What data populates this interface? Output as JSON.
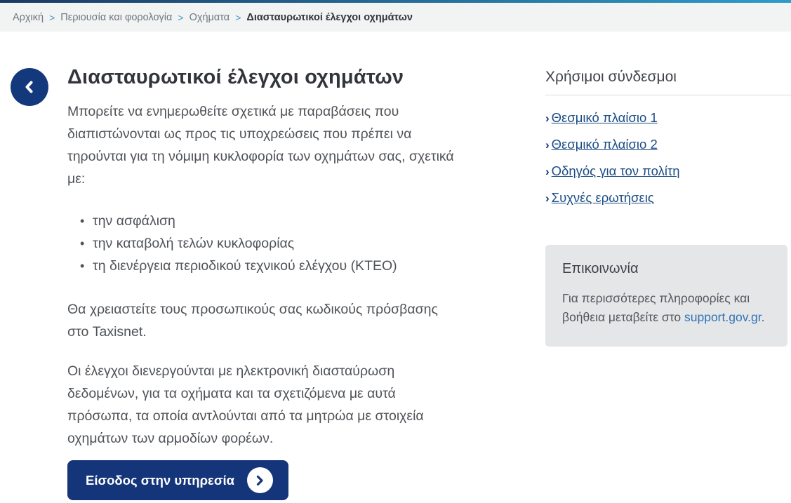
{
  "theme": {
    "accent_navy": "#13387b",
    "top_bar_gradient_start": "#1b3a64",
    "top_bar_gradient_end": "#2f9cc9",
    "sidebar_link_blue": "#1b4c86",
    "support_link_blue": "#3173b4",
    "contact_box_bg": "#e4e6e8",
    "breadcrumb_bg": "#f2f3f3"
  },
  "breadcrumb": {
    "separator": ">",
    "items": [
      {
        "label": "Αρχική"
      },
      {
        "label": "Περιουσία και φορολογία"
      },
      {
        "label": "Οχήματα"
      }
    ],
    "current": "Διασταυρωτικοί έλεγχοι οχημάτων"
  },
  "main": {
    "title": "Διασταυρωτικοί έλεγχοι οχημάτων",
    "intro": "Μπορείτε να  ενημερωθείτε σχετικά με παραβάσεις που διαπιστώνονται ως προς τις υποχρεώσεις που πρέπει να τηρούνται για τη νόμιμη κυκλοφορία των οχημάτων σας, σχετικά με:",
    "bullets": [
      "την ασφάλιση",
      "την καταβολή τελών κυκλοφορίας",
      "τη διενέργεια περιοδικού τεχνικού ελέγχου (ΚΤΕΟ)"
    ],
    "paragraph_credentials": "Θα χρειαστείτε τους προσωπικούς σας κωδικούς πρόσβασης στο Taxisnet.",
    "paragraph_checks": "Οι έλεγχοι διενεργούνται με ηλεκτρονική διασταύρωση δεδομένων, για τα οχήματα και τα σχετιζόμενα με αυτά πρόσωπα, τα οποία αντλούνται από τα μητρώα με στοιχεία οχημάτων των αρμοδίων φορέων.",
    "login_button_label": "Είσοδος στην υπηρεσία"
  },
  "sidebar": {
    "useful_links_title": "Χρήσιμοι σύνδεσμοι",
    "link_chevron": "›",
    "links": [
      {
        "label": "Θεσμικό πλαίσιο 1"
      },
      {
        "label": "Θεσμικό πλαίσιο 2"
      },
      {
        "label": "Οδηγός για τον πολίτη"
      },
      {
        "label": "Συχνές ερωτήσεις"
      }
    ],
    "contact": {
      "title": "Επικοινωνία",
      "text_before_link": "Για περισσότερες πληροφορίες και βοήθεια μεταβείτε στο ",
      "link_label": "support.gov.gr",
      "text_after_link": "."
    }
  }
}
